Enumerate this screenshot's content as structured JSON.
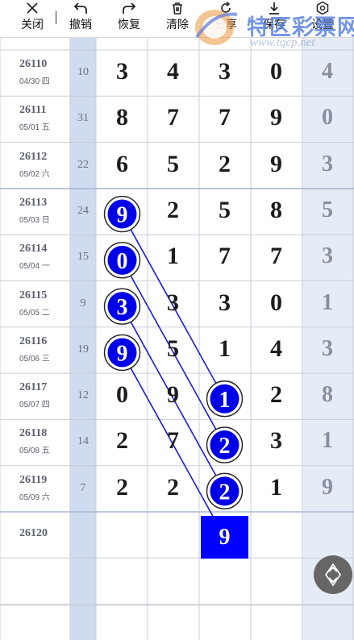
{
  "toolbar": {
    "close": "关闭",
    "undo": "撤销",
    "redo": "恢复",
    "clear": "清除",
    "share": "分享",
    "save": "保存",
    "settings": "设置"
  },
  "watermark": {
    "title": "特区彩票网",
    "url": "www.tqcp.net"
  },
  "rows": [
    {
      "issue": "26110",
      "date": "04/30 四",
      "sum": "10",
      "digits": [
        "3",
        "4",
        "3",
        "0"
      ],
      "tail": "4"
    },
    {
      "issue": "26111",
      "date": "05/01 五",
      "sum": "31",
      "digits": [
        "8",
        "7",
        "7",
        "9"
      ],
      "tail": "0"
    },
    {
      "issue": "26112",
      "date": "05/02 六",
      "sum": "22",
      "digits": [
        "6",
        "5",
        "2",
        "9"
      ],
      "tail": "3"
    },
    {
      "issue": "26113",
      "date": "05/03 日",
      "sum": "24",
      "digits": [
        "9",
        "2",
        "5",
        "8"
      ],
      "tail": "5"
    },
    {
      "issue": "26114",
      "date": "05/04 一",
      "sum": "15",
      "digits": [
        "0",
        "1",
        "7",
        "7"
      ],
      "tail": "3"
    },
    {
      "issue": "26115",
      "date": "05/05 二",
      "sum": "9",
      "digits": [
        "3",
        "3",
        "3",
        "0"
      ],
      "tail": "1"
    },
    {
      "issue": "26116",
      "date": "05/06 三",
      "sum": "19",
      "digits": [
        "9",
        "5",
        "1",
        "4"
      ],
      "tail": "3"
    },
    {
      "issue": "26117",
      "date": "05/07 四",
      "sum": "12",
      "digits": [
        "0",
        "9",
        "1",
        "2"
      ],
      "tail": "8"
    },
    {
      "issue": "26118",
      "date": "05/08 五",
      "sum": "14",
      "digits": [
        "2",
        "7",
        "2",
        "3"
      ],
      "tail": "1"
    },
    {
      "issue": "26119",
      "date": "05/09 六",
      "sum": "7",
      "digits": [
        "2",
        "2",
        "2",
        "1"
      ],
      "tail": "9"
    },
    {
      "issue": "26120",
      "date": "",
      "sum": "",
      "digits": [
        "",
        "",
        "",
        ""
      ],
      "tail": ""
    }
  ],
  "highlight": {
    "balls": [
      {
        "row": 3,
        "col": 0,
        "value": "9"
      },
      {
        "row": 4,
        "col": 0,
        "value": "0"
      },
      {
        "row": 5,
        "col": 0,
        "value": "3"
      },
      {
        "row": 6,
        "col": 0,
        "value": "9"
      },
      {
        "row": 7,
        "col": 2,
        "value": "1"
      },
      {
        "row": 8,
        "col": 2,
        "value": "2"
      },
      {
        "row": 9,
        "col": 2,
        "value": "2"
      }
    ],
    "lines": [
      [
        3,
        7
      ],
      [
        4,
        8
      ],
      [
        5,
        9
      ],
      [
        6,
        10
      ]
    ],
    "target": {
      "row": 10,
      "col": 2,
      "value": "9"
    },
    "ball_color": "#0000e6",
    "line_color": "#1a1ae0"
  },
  "colors": {
    "sum_column_bg": "#cfdcf0",
    "tail_column_bg": "#e6ecf5",
    "grid_line": "#c9ced8",
    "group_line": "#a9b8d6"
  }
}
